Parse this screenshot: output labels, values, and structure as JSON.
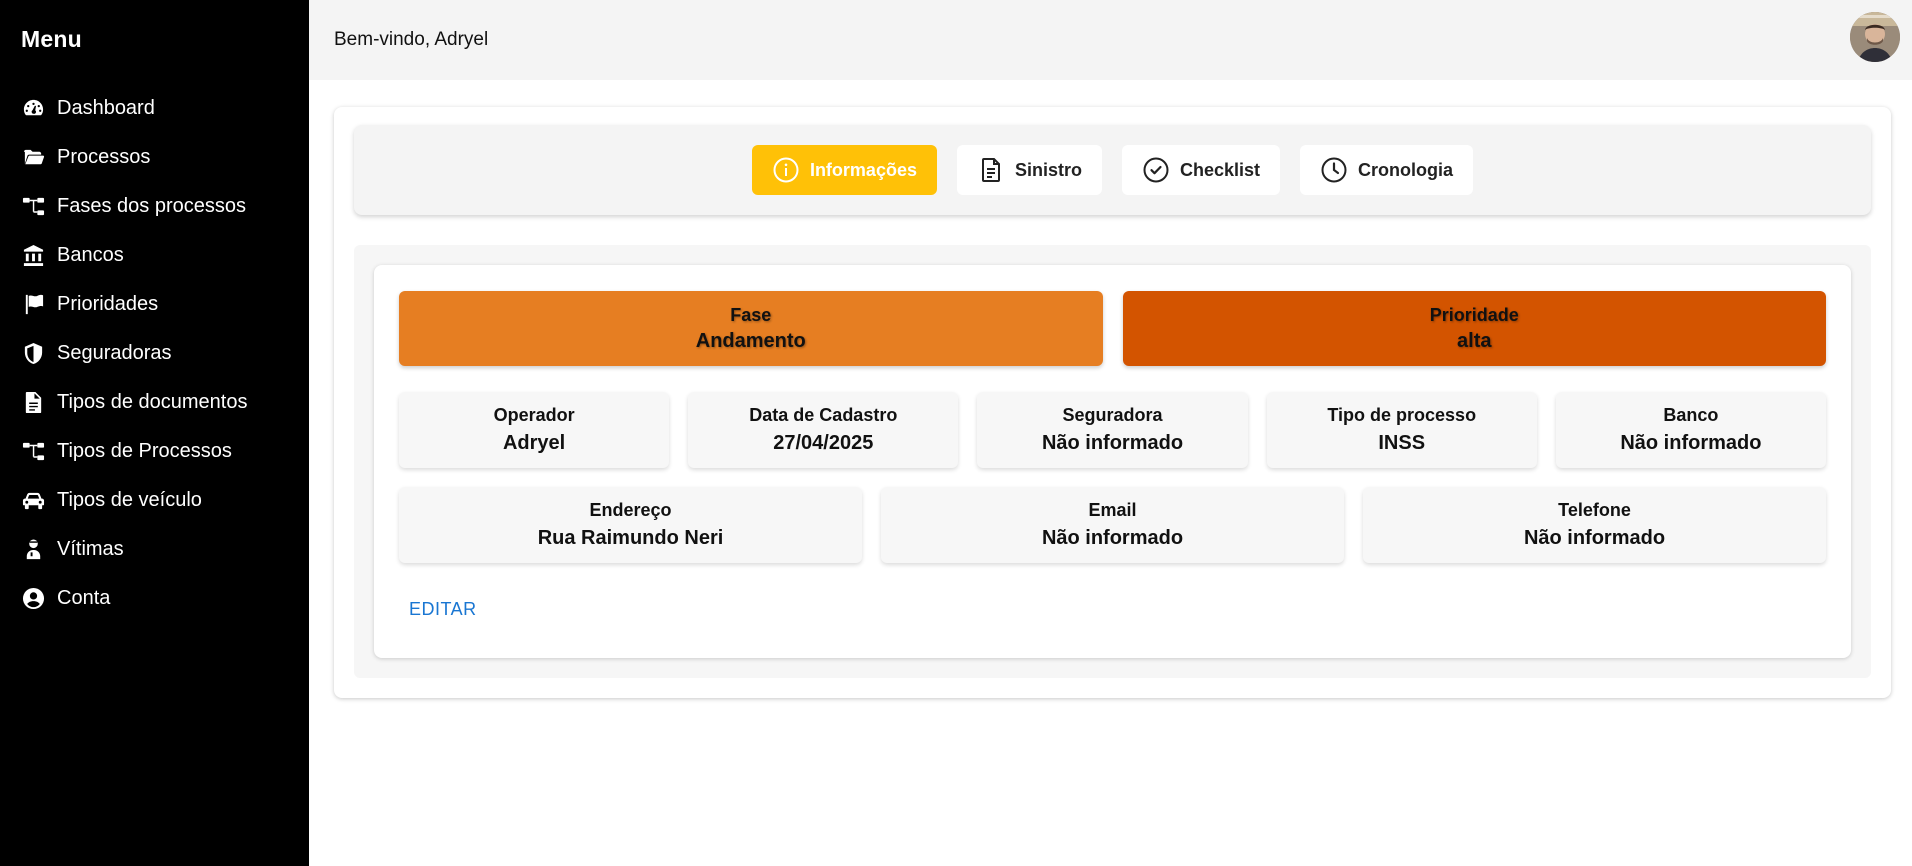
{
  "sidebar": {
    "title": "Menu",
    "items": [
      {
        "label": "Dashboard",
        "icon": "dashboard-icon"
      },
      {
        "label": "Processos",
        "icon": "folder-open-icon"
      },
      {
        "label": "Fases dos processos",
        "icon": "sitemap-icon"
      },
      {
        "label": "Bancos",
        "icon": "bank-icon"
      },
      {
        "label": "Prioridades",
        "icon": "flag-icon"
      },
      {
        "label": "Seguradoras",
        "icon": "shield-icon"
      },
      {
        "label": "Tipos de documentos",
        "icon": "document-icon"
      },
      {
        "label": "Tipos de Processos",
        "icon": "sitemap-icon"
      },
      {
        "label": "Tipos de veículo",
        "icon": "car-icon"
      },
      {
        "label": "Vítimas",
        "icon": "user-injured-icon"
      },
      {
        "label": "Conta",
        "icon": "user-circle-icon"
      }
    ]
  },
  "header": {
    "welcome": "Bem-vindo, Adryel",
    "avatar": "avatar"
  },
  "tabs": [
    {
      "label": "Informações",
      "icon": "info-icon",
      "active": true
    },
    {
      "label": "Sinistro",
      "icon": "document-icon",
      "active": false
    },
    {
      "label": "Checklist",
      "icon": "check-circle-icon",
      "active": false
    },
    {
      "label": "Cronologia",
      "icon": "clock-icon",
      "active": false
    }
  ],
  "status": {
    "fase": {
      "label": "Fase",
      "value": "Andamento",
      "color": "#e67e22"
    },
    "prioridade": {
      "label": "Prioridade",
      "value": "alta",
      "color": "#d35400"
    }
  },
  "info_row1": [
    {
      "label": "Operador",
      "value": "Adryel"
    },
    {
      "label": "Data de Cadastro",
      "value": "27/04/2025"
    },
    {
      "label": "Seguradora",
      "value": "Não informado"
    },
    {
      "label": "Tipo de processo",
      "value": "INSS"
    },
    {
      "label": "Banco",
      "value": "Não informado"
    }
  ],
  "info_row2": [
    {
      "label": "Endereço",
      "value": "Rua Raimundo Neri"
    },
    {
      "label": "Email",
      "value": "Não informado"
    },
    {
      "label": "Telefone",
      "value": "Não informado"
    }
  ],
  "actions": {
    "edit_label": "EDITAR"
  },
  "colors": {
    "accent": "#ffc107",
    "link": "#1976d2",
    "sidebar_bg": "#000000"
  }
}
